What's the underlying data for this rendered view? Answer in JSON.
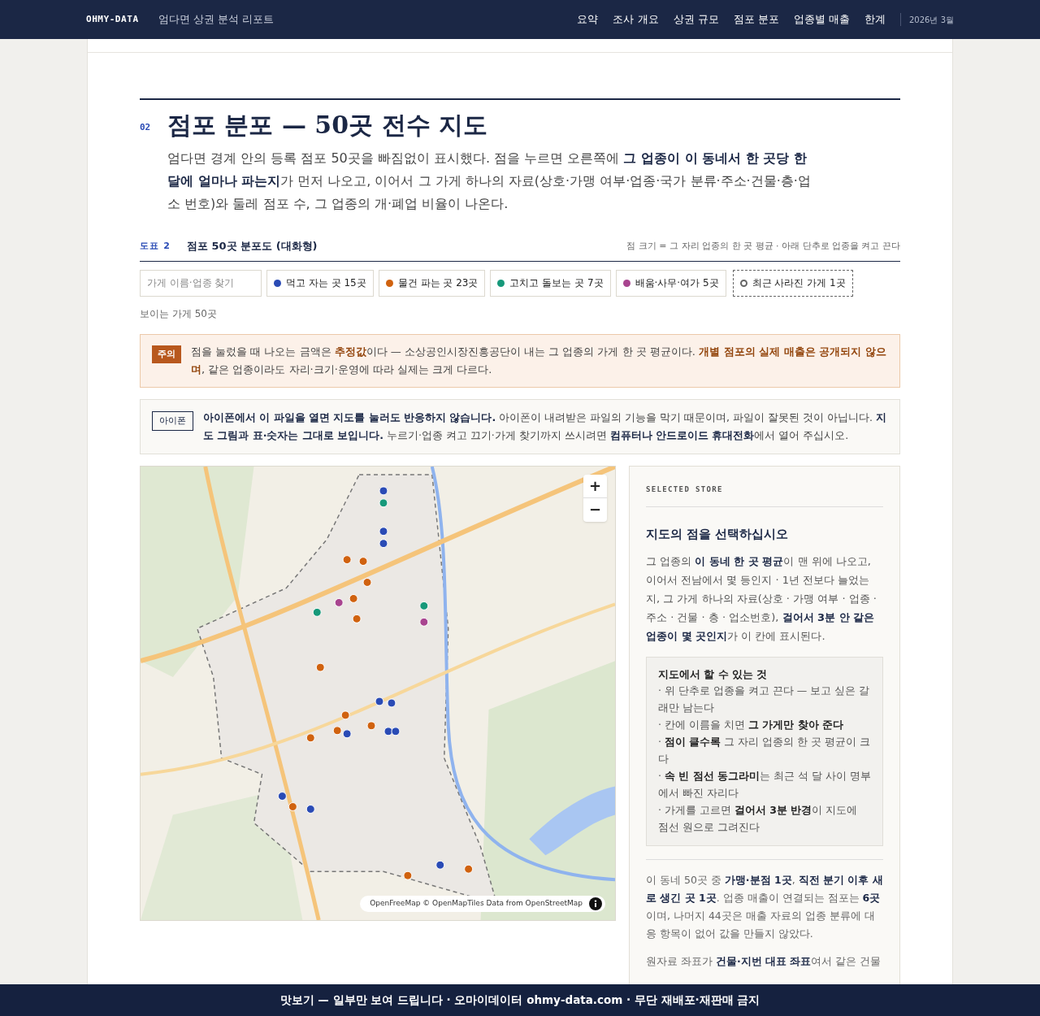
{
  "header": {
    "brand": "OHMY-DATA",
    "subtitle": "엄다면 상권 분석 리포트",
    "nav": [
      "요약",
      "조사 개요",
      "상권 규모",
      "점포 분포",
      "업종별 매출",
      "한계"
    ],
    "date": "2026년 3월"
  },
  "section": {
    "number": "02",
    "title": "점포 분포 — 50곳 전수 지도",
    "intro": "엄다면 경계 안의 등록 점포 50곳을 빠짐없이 표시했다. 점을 누르면 오른쪽에 **그 업종이 이 동네서 한 곳당 한 달에 얼마나 파는지**가 먼저 나오고, 이어서 그 가게 하나의 자료(상호·가맹 여부·업종·국가 분류·주소·건물·층·업소 번호)와 둘레 점포 수, 그 업종의 개·폐업 비율이 나온다."
  },
  "figure": {
    "label": "도표 2",
    "title": "점포 50곳 분포도 (대화형)",
    "note": "점 크기 = 그 자리 업종의 한 곳 평균 · 아래 단추로 업종을 켜고 끈다"
  },
  "search": {
    "placeholder": "가게 이름·업종 찾기"
  },
  "filters": [
    {
      "kind": "category",
      "label": "먹고 자는 곳 15곳",
      "color": "#2a4bb5"
    },
    {
      "kind": "category",
      "label": "물건 파는 곳 23곳",
      "color": "#d0620f"
    },
    {
      "kind": "category",
      "label": "고치고 돌보는 곳 7곳",
      "color": "#16997a"
    },
    {
      "kind": "category",
      "label": "배움·사무·여가 5곳",
      "color": "#a8448f"
    },
    {
      "kind": "closed",
      "label": "최근 사라진 가게 1곳"
    }
  ],
  "visible_count": "보이는 가게 50곳",
  "caution": {
    "badge": "주의",
    "text": "점을 눌렀을 때 나오는 금액은 **추정값**이다 — 소상공인시장진흥공단이 내는 그 업종의 가게 한 곳 평균이다. **개별 점포의 실제 매출은 공개되지 않으며**, 같은 업종이라도 자리·크기·운영에 따라 실제는 크게 다르다."
  },
  "iphone": {
    "badge": "아이폰",
    "text": "**아이폰에서 이 파일을 열면 지도를 눌러도 반응하지 않습니다.** 아이폰이 내려받은 파일의 기능을 막기 때문이며, 파일이 잘못된 것이 아닙니다. **지도 그림과 표·숫자는 그대로 보입니다.** 누르기·업종 켜고 끄기·가게 찾기까지 쓰시려면 **컴퓨터나 안드로이드 휴대전화**에서 열어 주십시오."
  },
  "map": {
    "zoom_in": "+",
    "zoom_out": "−",
    "attribution": "OpenFreeMap © OpenMapTiles Data from OpenStreetMap"
  },
  "panel": {
    "eyebrow": "SELECTED STORE",
    "heading": "지도의 점을 선택하십시오",
    "description": "그 업종의 **이 동네 한 곳 평균**이 맨 위에 나오고, 이어서 전남에서 몇 등인지 · 1년 전보다 늘었는지, 그 가게 하나의 자료(상호 · 가맹 여부 · 업종 · 주소 · 건물 · 층 · 업소번호), **걸어서 3분 안 같은 업종이 몇 곳인지**가 이 칸에 표시된다.",
    "tips": {
      "title": "지도에서 할 수 있는 것",
      "items": [
        "· 위 단추로 업종을 켜고 끈다 — 보고 싶은 갈래만 남는다",
        "· 칸에 이름을 치면 **그 가게만 찾아 준다**",
        "· **점이 클수록** 그 자리 업종의 한 곳 평균이 크다",
        "· **속 빈 점선 동그라미**는 최근 석 달 사이 명부에서 빠진 자리다",
        "· 가게를 고르면 **걸어서 3분 반경**이 지도에 점선 원으로 그려진다"
      ]
    },
    "summary": "이 동네 50곳 중 **가맹·분점 1곳**, **직전 분기 이후 새로 생긴 곳 1곳**. 업종 매출이 연결되는 점포는 **6곳**이며, 나머지 44곳은 매출 자료의 업종 분류에 대응 항목이 없어 값을 만들지 않았다.",
    "note": "원자료 좌표가 **건물·지번 대표 좌표**여서 같은 건물"
  },
  "banner": "맛보기 — 일부만 보여 드립니다 · 오마이데이터 ohmy-data.com · 무단 재배포·재판매 금지"
}
